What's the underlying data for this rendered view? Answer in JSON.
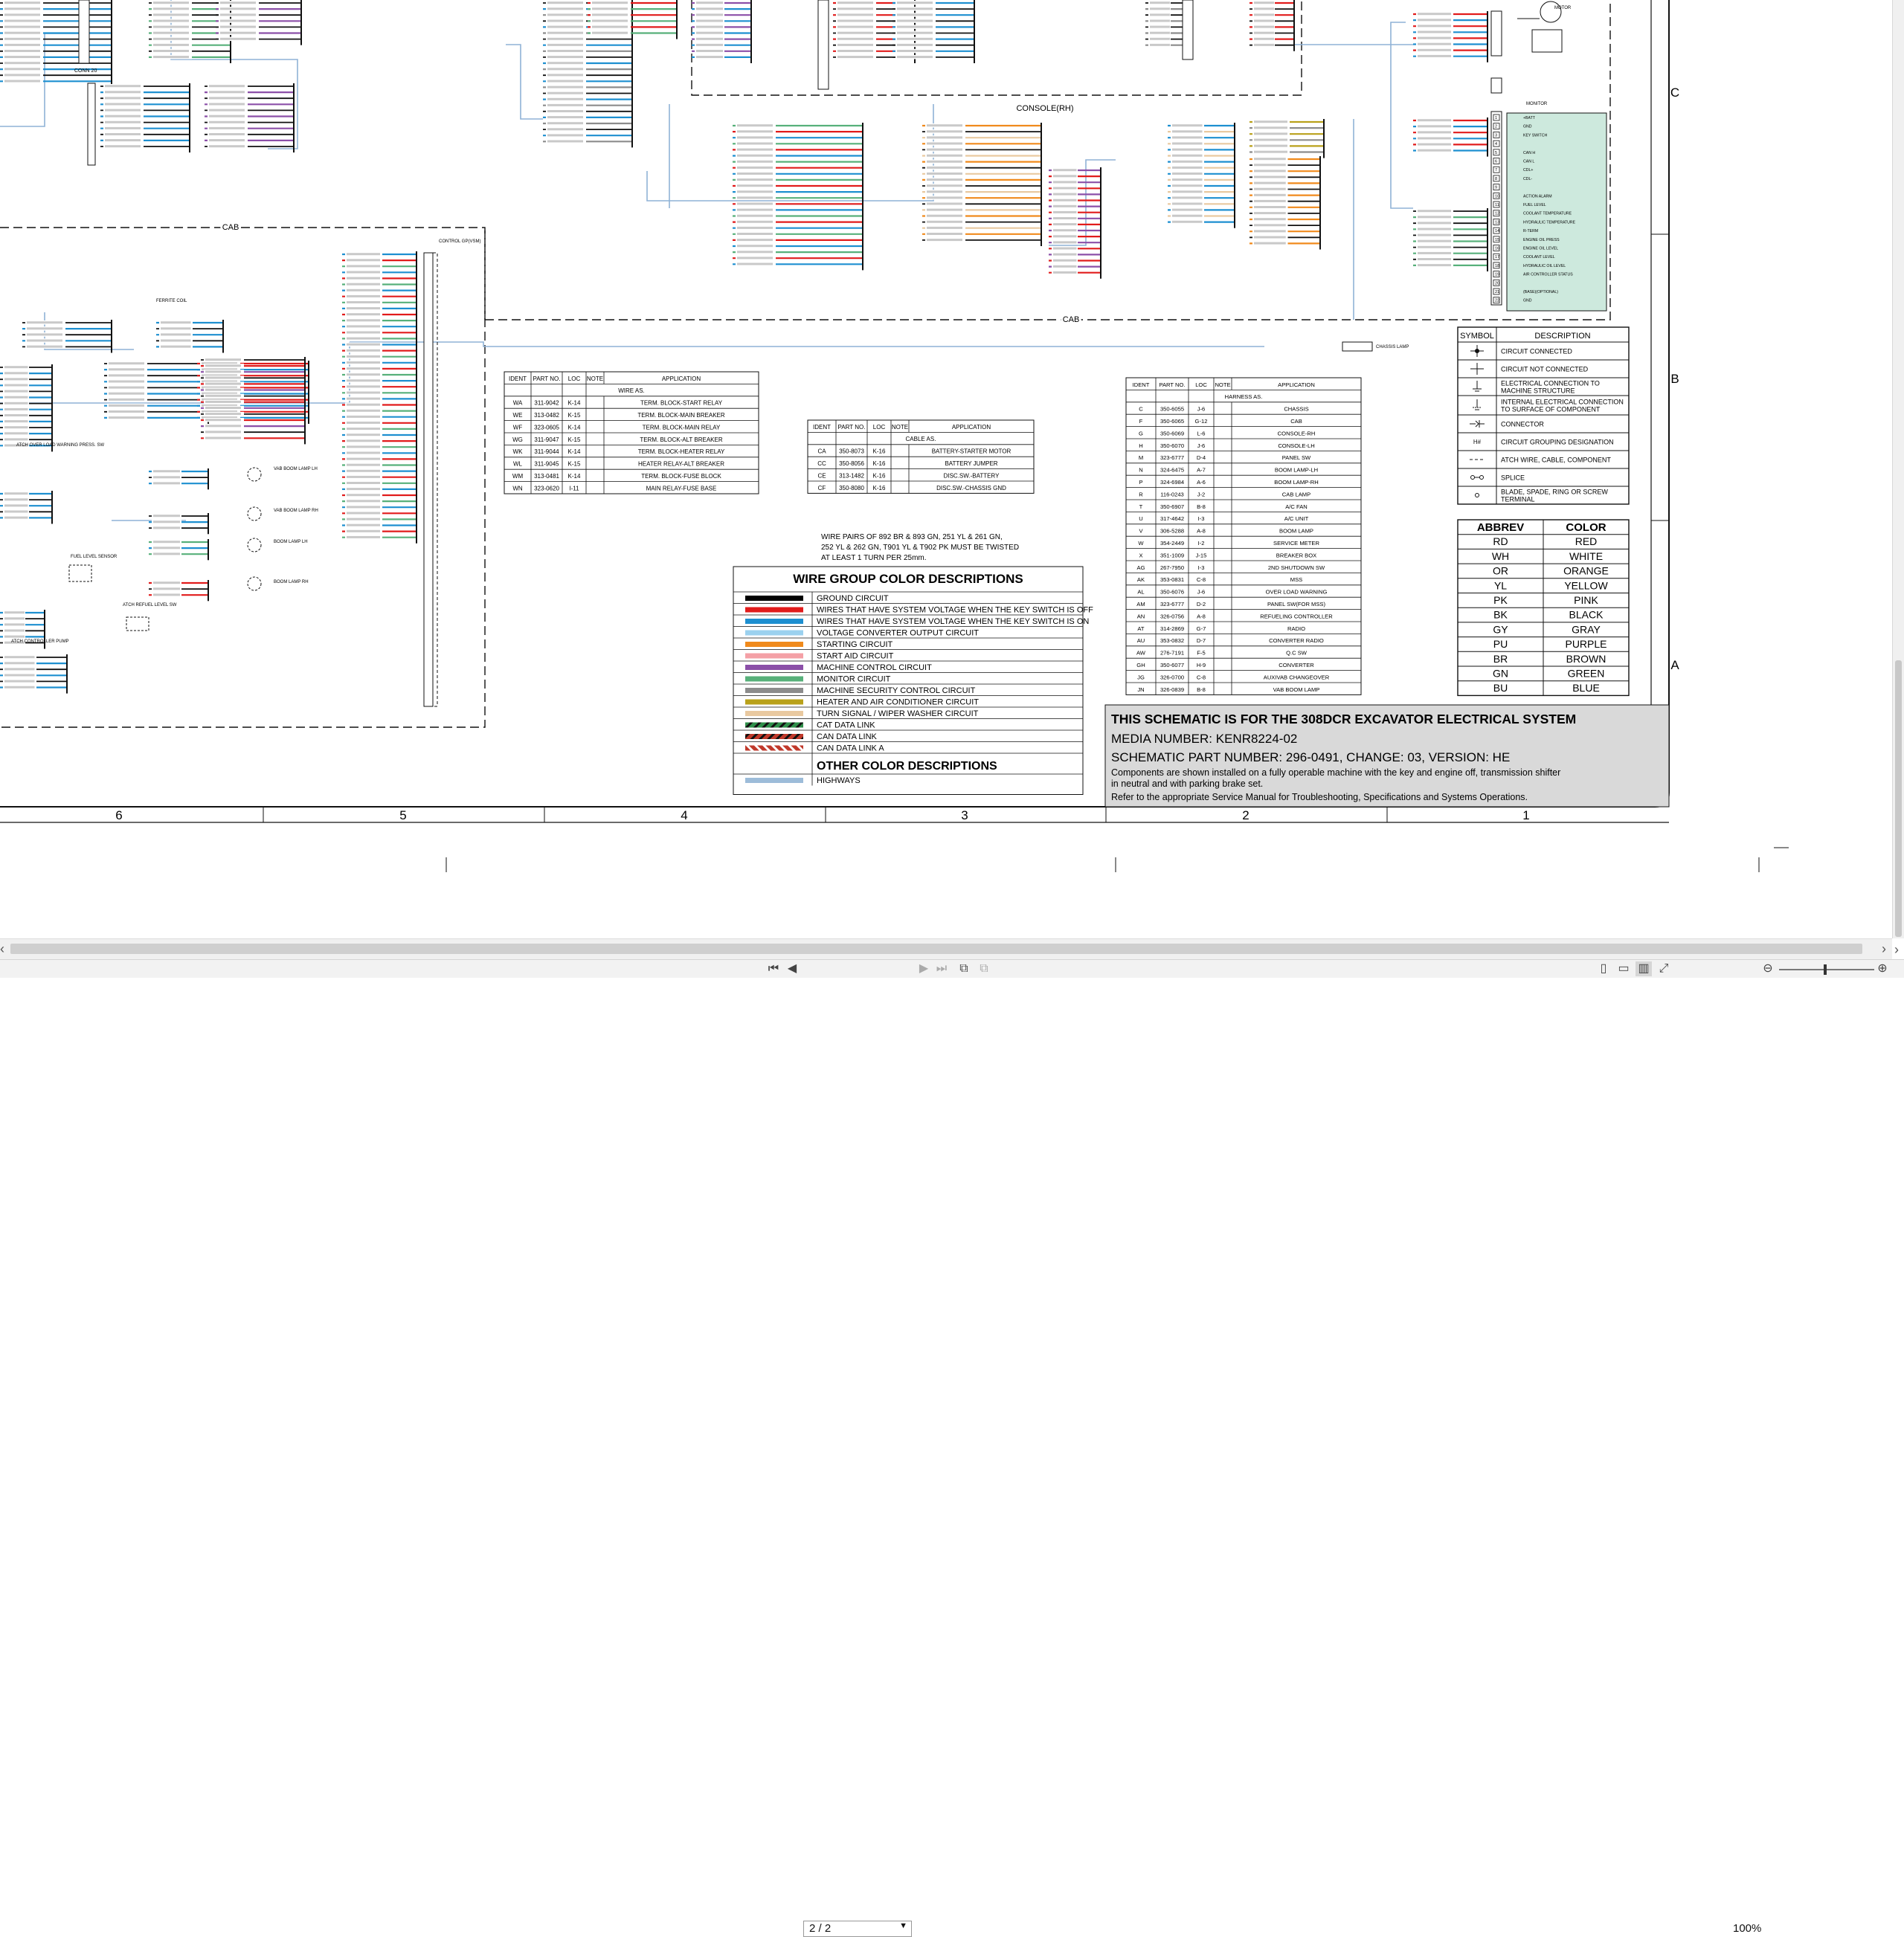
{
  "viewer": {
    "page_current": "2 / 2",
    "zoom": "100%"
  },
  "grid": {
    "columns": [
      "6",
      "5",
      "4",
      "3",
      "2",
      "1"
    ],
    "rows": [
      "C",
      "B",
      "A"
    ]
  },
  "regions": {
    "cab_upper": "CAB",
    "cab_lower": "CAB",
    "console_rh": "CONSOLE(RH)"
  },
  "conn": {
    "conn20": "CONN 20",
    "monitor": "MONITOR",
    "motor": "MOTOR",
    "control_group": "CONTROL GP(VSM)",
    "chassis_lamp": "CHASSIS LAMP",
    "ferrite_coil": "FERRITE COIL",
    "fuel_level_sensor": "FUEL LEVEL SENSOR",
    "atch_refuel_sw": "ATCH REFUEL LEVEL SW",
    "atch_controller_pump": "ATCH CONTROLLER PUMP",
    "atch_overload": "ATCH OVER LOAD WARNING PRESS. SW",
    "vab_boom_lamp_lh": "VAB BOOM LAMP LH",
    "vab_boom_lamp_rh": "VAB BOOM LAMP RH",
    "boom_lamp_lh": "BOOM LAMP LH",
    "boom_lamp_rh": "BOOM LAMP RH"
  },
  "monitor_pins": [
    "+BATT",
    "GND",
    "KEY SWITCH",
    "",
    "CAN H",
    "CAN L",
    "CDL+",
    "CDL-",
    "",
    "ACTION ALARM",
    "FUEL LEVEL",
    "COOLANT TEMPERATURE",
    "HYDRAULIC TEMPERATURE",
    "R-TERM",
    "ENGINE OIL PRESS",
    "ENGINE OIL LEVEL",
    "COOLANT LEVEL",
    "HYDRAULIC OIL LEVEL",
    "AIR CONTROLLER STATUS",
    "",
    "(BASE)(OPTIONAL)",
    "GND"
  ],
  "wire_table": {
    "headers": [
      "IDENT",
      "PART NO.",
      "LOC",
      "NOTE",
      "APPLICATION"
    ],
    "section": "WIRE AS.",
    "rows": [
      [
        "WA",
        "311-9042",
        "K-14",
        "",
        "TERM. BLOCK-START RELAY"
      ],
      [
        "WE",
        "313-0482",
        "K-15",
        "",
        "TERM. BLOCK-MAIN BREAKER"
      ],
      [
        "WF",
        "323-0605",
        "K-14",
        "",
        "TERM. BLOCK-MAIN RELAY"
      ],
      [
        "WG",
        "311-9047",
        "K-15",
        "",
        "TERM. BLOCK-ALT BREAKER"
      ],
      [
        "WK",
        "311-9044",
        "K-14",
        "",
        "TERM. BLOCK-HEATER RELAY"
      ],
      [
        "WL",
        "311-9045",
        "K-15",
        "",
        "HEATER RELAY-ALT BREAKER"
      ],
      [
        "WM",
        "313-0481",
        "K-14",
        "",
        "TERM. BLOCK-FUSE BLOCK"
      ],
      [
        "WN",
        "323-0620",
        "I-11",
        "",
        "MAIN RELAY-FUSE BASE"
      ]
    ]
  },
  "cable_table": {
    "headers": [
      "IDENT",
      "PART NO.",
      "LOC",
      "NOTE",
      "APPLICATION"
    ],
    "section": "CABLE AS.",
    "rows": [
      [
        "CA",
        "350-8073",
        "K-16",
        "",
        "BATTERY-STARTER MOTOR"
      ],
      [
        "CC",
        "350-8056",
        "K-16",
        "",
        "BATTERY JUMPER"
      ],
      [
        "CE",
        "313-1482",
        "K-16",
        "",
        "DISC.SW.-BATTERY"
      ],
      [
        "CF",
        "350-8080",
        "K-16",
        "",
        "DISC.SW.-CHASSIS GND"
      ]
    ]
  },
  "harness_table": {
    "headers": [
      "IDENT",
      "PART NO.",
      "LOC",
      "NOTE",
      "APPLICATION"
    ],
    "section": "HARNESS AS.",
    "rows": [
      [
        "C",
        "350-6055",
        "J-6",
        "",
        "CHASSIS"
      ],
      [
        "F",
        "350-6065",
        "G-12",
        "",
        "CAB"
      ],
      [
        "G",
        "350-6069",
        "L-6",
        "",
        "CONSOLE-RH"
      ],
      [
        "H",
        "350-6070",
        "J-6",
        "",
        "CONSOLE-LH"
      ],
      [
        "M",
        "323-6777",
        "D-4",
        "",
        "PANEL SW"
      ],
      [
        "N",
        "324-6475",
        "A-7",
        "",
        "BOOM LAMP-LH"
      ],
      [
        "P",
        "324-6984",
        "A-6",
        "",
        "BOOM LAMP-RH"
      ],
      [
        "R",
        "116-0243",
        "J-2",
        "",
        "CAB LAMP"
      ],
      [
        "T",
        "350-6907",
        "B-8",
        "",
        "A/C FAN"
      ],
      [
        "U",
        "317-4642",
        "I-3",
        "",
        "A/C UNIT"
      ],
      [
        "V",
        "306-5288",
        "A-8",
        "",
        "BOOM LAMP"
      ],
      [
        "W",
        "354-2449",
        "I-2",
        "",
        "SERVICE METER"
      ],
      [
        "X",
        "351-1009",
        "J-15",
        "",
        "BREAKER BOX"
      ],
      [
        "AG",
        "267-7950",
        "I-3",
        "",
        "2ND SHUTDOWN SW"
      ],
      [
        "AK",
        "353-0831",
        "C-8",
        "",
        "MSS"
      ],
      [
        "AL",
        "350-6076",
        "J-6",
        "",
        "OVER LOAD WARNING"
      ],
      [
        "AM",
        "323-6777",
        "D-2",
        "",
        "PANEL SW(FOR MSS)"
      ],
      [
        "AN",
        "326-0756",
        "A-8",
        "",
        "REFUELING CONTROLLER"
      ],
      [
        "AT",
        "314-2869",
        "G-7",
        "",
        "RADIO"
      ],
      [
        "AU",
        "353-0832",
        "D-7",
        "",
        "CONVERTER RADIO"
      ],
      [
        "AW",
        "276-7191",
        "F-5",
        "",
        "Q.C SW"
      ],
      [
        "GH",
        "350-6077",
        "H-9",
        "",
        "CONVERTER"
      ],
      [
        "JG",
        "326-0700",
        "C-8",
        "",
        "AUXIVAB CHANGEOVER"
      ],
      [
        "JN",
        "326-0839",
        "B-8",
        "",
        "VAB BOOM LAMP"
      ]
    ]
  },
  "note": "WIRE PAIRS OF 892 BR & 893 GN, 251 YL & 261 GN, 252 YL & 262 GN, T901 YL & T902 PK MUST BE TWISTED AT LEAST 1 TURN PER 25mm.",
  "wire_colors": {
    "title": "WIRE GROUP COLOR DESCRIPTIONS",
    "items": [
      {
        "label": "GROUND CIRCUIT",
        "color": "#000000",
        "pattern": "solid"
      },
      {
        "label": "WIRES THAT HAVE SYSTEM VOLTAGE WHEN THE KEY SWITCH IS OFF",
        "color": "#e11b1b",
        "pattern": "solid"
      },
      {
        "label": "WIRES THAT HAVE SYSTEM VOLTAGE WHEN THE KEY SWITCH IS ON",
        "color": "#1d8fd0",
        "pattern": "solid"
      },
      {
        "label": "VOLTAGE CONVERTER OUTPUT CIRCUIT",
        "color": "#9bd1ef",
        "pattern": "solid"
      },
      {
        "label": "STARTING CIRCUIT",
        "color": "#f08a1c",
        "pattern": "solid"
      },
      {
        "label": "START AID CIRCUIT",
        "color": "#f4a0a6",
        "pattern": "solid"
      },
      {
        "label": "MACHINE CONTROL CIRCUIT",
        "color": "#8b4fa8",
        "pattern": "solid"
      },
      {
        "label": "MONITOR CIRCUIT",
        "color": "#57b07a",
        "pattern": "solid"
      },
      {
        "label": "MACHINE SECURITY CONTROL CIRCUIT",
        "color": "#8c8c8c",
        "pattern": "solid"
      },
      {
        "label": "HEATER AND AIR CONDITIONER CIRCUIT",
        "color": "#b9a11a",
        "pattern": "solid"
      },
      {
        "label": "TURN SIGNAL / WIPER WASHER CIRCUIT",
        "color": "#e9c9a0",
        "pattern": "solid"
      },
      {
        "label": "CAT DATA LINK",
        "color": "#2f8f4a",
        "pattern": "hatch"
      },
      {
        "label": "CAN DATA LINK",
        "color": "#c0392b",
        "pattern": "hatch"
      },
      {
        "label": "CAN DATA LINK A",
        "color": "#c0392b",
        "pattern": "hatch2"
      }
    ],
    "other_title": "OTHER COLOR DESCRIPTIONS",
    "other_items": [
      {
        "label": "HIGHWAYS",
        "color": "#9dbcd9",
        "pattern": "solid"
      }
    ]
  },
  "symbols": {
    "headers": [
      "SYMBOL",
      "DESCRIPTION"
    ],
    "rows": [
      {
        "icon": "circuit-connected-icon",
        "desc": "CIRCUIT CONNECTED"
      },
      {
        "icon": "circuit-not-connected-icon",
        "desc": "CIRCUIT NOT CONNECTED"
      },
      {
        "icon": "electrical-connection-structure-icon",
        "desc": "ELECTRICAL CONNECTION TO MACHINE STRUCTURE"
      },
      {
        "icon": "internal-connection-surface-icon",
        "desc": "INTERNAL ELECTRICAL CONNECTION TO SURFACE OF COMPONENT"
      },
      {
        "icon": "connector-icon",
        "desc": "CONNECTOR"
      },
      {
        "icon": "circuit-grouping-icon",
        "desc": "CIRCUIT GROUPING DESIGNATION"
      },
      {
        "icon": "atch-wire-icon",
        "desc": "ATCH WIRE, CABLE, COMPONENT"
      },
      {
        "icon": "splice-icon",
        "desc": "SPLICE"
      },
      {
        "icon": "blade-terminal-icon",
        "desc": "BLADE, SPADE, RING OR SCREW TERMINAL"
      }
    ]
  },
  "abbrev": {
    "headers": [
      "ABBREV",
      "COLOR"
    ],
    "rows": [
      [
        "RD",
        "RED"
      ],
      [
        "WH",
        "WHITE"
      ],
      [
        "OR",
        "ORANGE"
      ],
      [
        "YL",
        "YELLOW"
      ],
      [
        "PK",
        "PINK"
      ],
      [
        "BK",
        "BLACK"
      ],
      [
        "GY",
        "GRAY"
      ],
      [
        "PU",
        "PURPLE"
      ],
      [
        "BR",
        "BROWN"
      ],
      [
        "GN",
        "GREEN"
      ],
      [
        "BU",
        "BLUE"
      ]
    ]
  },
  "title_block": {
    "title": "THIS SCHEMATIC IS FOR THE 308DCR EXCAVATOR ELECTRICAL SYSTEM",
    "media": "MEDIA NUMBER: KENR8224-02",
    "part": "SCHEMATIC PART NUMBER: 296-0491, CHANGE: 03, VERSION: HE",
    "desc1": "Components are shown installed on a fully operable machine with the key and engine off, transmission shifter",
    "desc2": "in neutral and with parking brake set.",
    "desc3": "Refer to the appropriate Service Manual for Troubleshooting, Specifications and Systems Operations."
  }
}
